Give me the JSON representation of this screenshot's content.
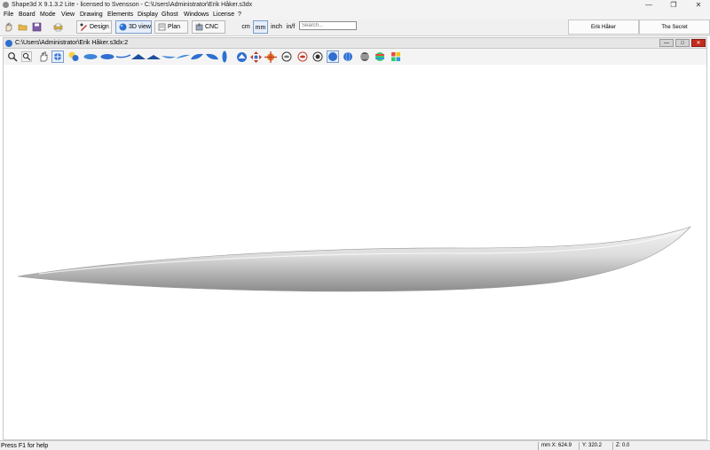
{
  "window": {
    "title": "Shape3d X 9.1.3.2 Lite - licensed to Svensson - C:\\Users\\Administrator\\Erik Håker.s3dx",
    "minimize_glyph": "—",
    "maximize_glyph": "❐",
    "close_glyph": "✕"
  },
  "menu": [
    "File",
    "Board",
    "Mode",
    "View",
    "Drawing",
    "Elements",
    "Display",
    "Ghost",
    "Windows",
    "License",
    "?"
  ],
  "toolbar": {
    "design_label": "Design",
    "view3d_label": "3D view",
    "plan_label": "Plan",
    "cnc_label": "CNC",
    "units": [
      "cm",
      "mm",
      "inch",
      "in/f"
    ],
    "active_unit": "mm",
    "search_placeholder": "Search...",
    "user_tabs": [
      "Erik Håker",
      "The Secret"
    ]
  },
  "document": {
    "path": "C:\\Users\\Administrator\\Erik Håker.s3dx:2",
    "btn_min": "—",
    "btn_max": "□",
    "btn_close": "✕"
  },
  "view_tools": [
    "zoom-icon",
    "zoom-window-icon",
    "pan-icon",
    "rotate-icon",
    "color-icon",
    "bottom-view-icon",
    "deck-view-icon",
    "profile-view-icon",
    "tail-view-icon",
    "nose-view-icon",
    "side-left-icon",
    "side-right-icon",
    "rear-quarter-icon",
    "front-quarter-icon",
    "top-quarter-icon",
    "vertical-view-icon",
    "orbit-icon",
    "move-icon",
    "axes-icon",
    "circle-a-icon",
    "circle-b-icon",
    "circle-c-icon",
    "shaded-icon",
    "wire-icon",
    "slices-icon",
    "rainbow-icon",
    "grid-colors-icon"
  ],
  "status": {
    "help": "Press F1 for help",
    "x": "mm X: 624.9",
    "y": "Y: 320.2",
    "z": "Z: 0.0"
  },
  "colors": {
    "accent": "#2f6fd0",
    "board_light": "#ececec",
    "board_dark": "#8a8a8a"
  }
}
